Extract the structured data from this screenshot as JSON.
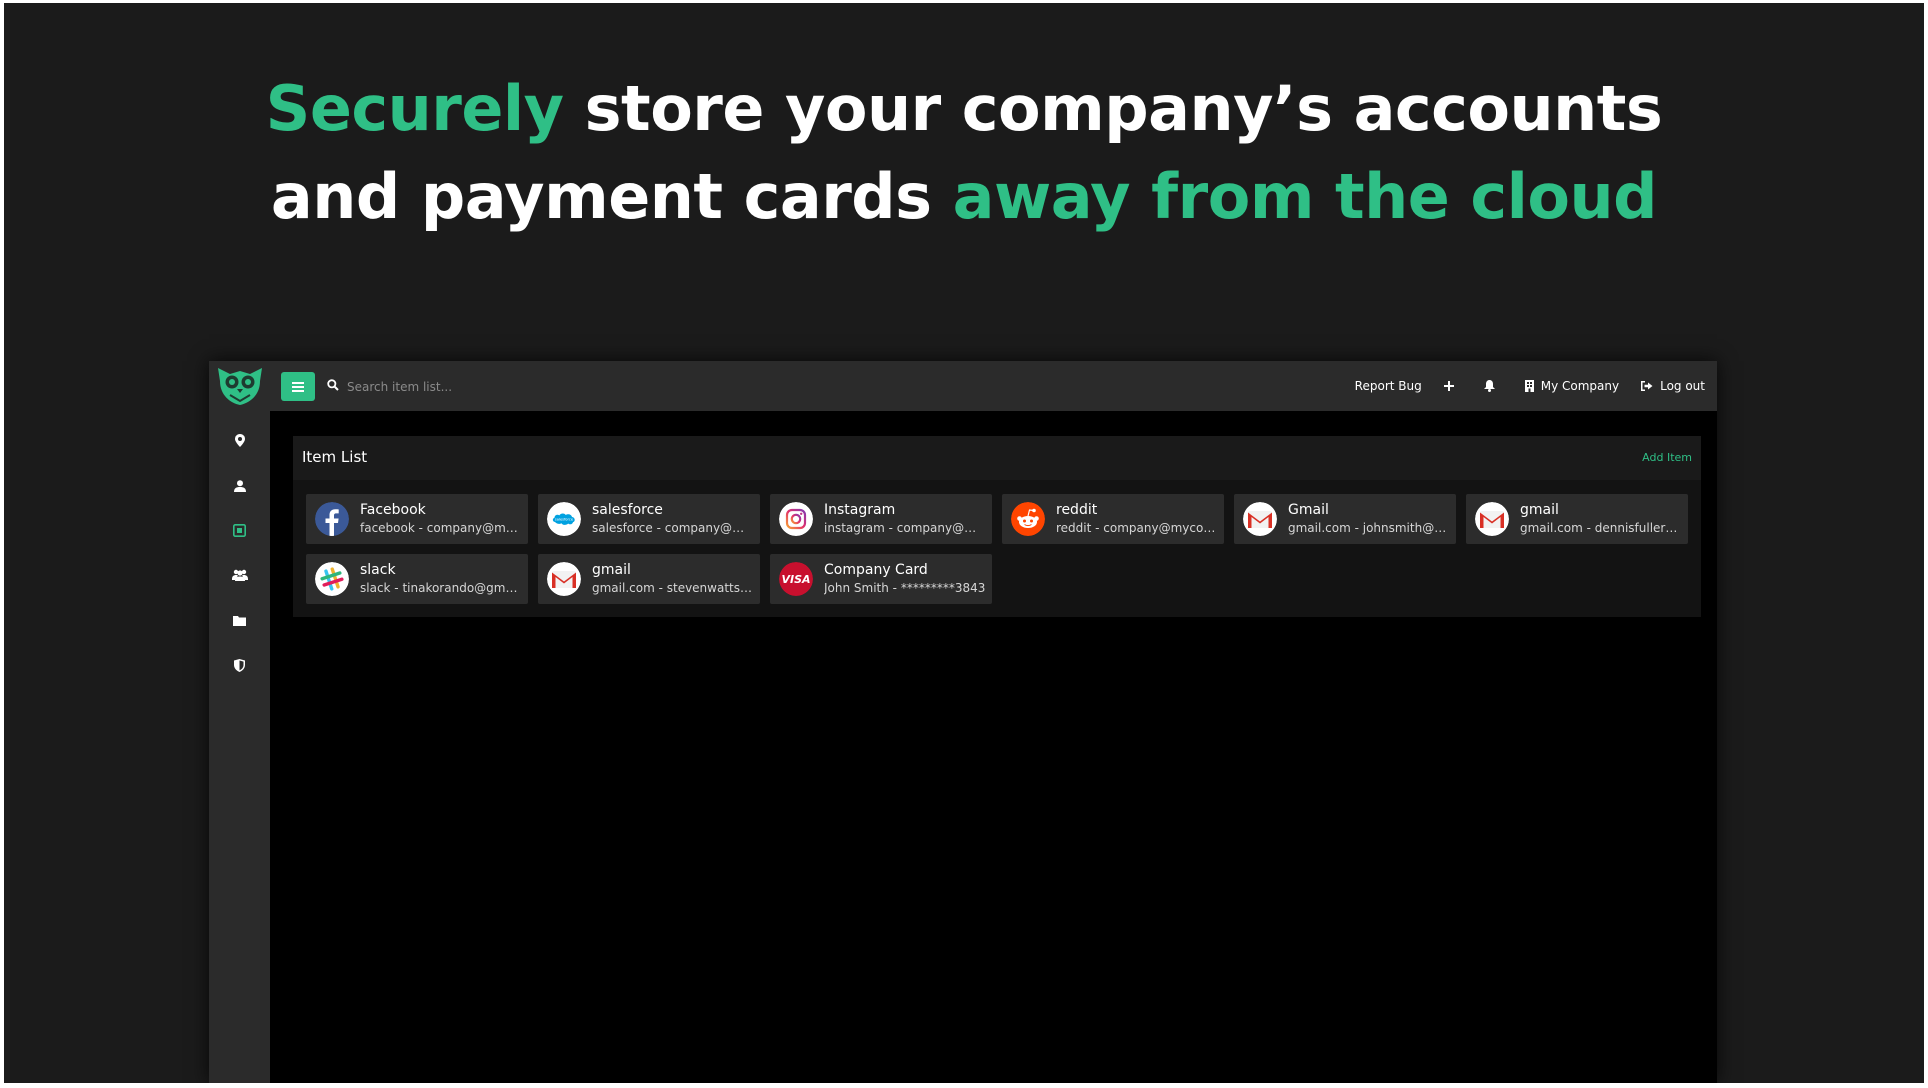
{
  "headline": {
    "line1_accent": "Securely",
    "line1_rest": " store your company’s accounts",
    "line2_start": "and payment cards ",
    "line2_accent": "away from the cloud"
  },
  "colors": {
    "accent": "#2fbf86",
    "sidebar": "#2b2b2b",
    "card": "#2c2c2c"
  },
  "sidebar": {
    "logo_icon": "owl-logo",
    "items": [
      {
        "icon": "map-pin-icon"
      },
      {
        "icon": "user-icon"
      },
      {
        "icon": "vault-icon",
        "active": true
      },
      {
        "icon": "users-icon"
      },
      {
        "icon": "folder-icon"
      },
      {
        "icon": "shield-icon"
      }
    ]
  },
  "topbar": {
    "search_placeholder": "Search item list...",
    "report_bug": "Report Bug",
    "company": "My Company",
    "logout": "Log out"
  },
  "panel": {
    "title": "Item List",
    "add_label": "Add Item"
  },
  "items": [
    {
      "name": "Facebook",
      "sub": "facebook - company@mycompany.com",
      "icon": "facebook-icon"
    },
    {
      "name": "salesforce",
      "sub": "salesforce - company@mycompany.com",
      "icon": "salesforce-icon"
    },
    {
      "name": "Instagram",
      "sub": "instagram - company@mycompany.com",
      "icon": "instagram-icon"
    },
    {
      "name": "reddit",
      "sub": "reddit - company@mycompany.com",
      "icon": "reddit-icon"
    },
    {
      "name": "Gmail",
      "sub": "gmail.com - johnsmith@gmail.com",
      "icon": "gmail-icon"
    },
    {
      "name": "gmail",
      "sub": "gmail.com - dennisfuller@gmail.com",
      "icon": "gmail-icon"
    },
    {
      "name": "slack",
      "sub": "slack - tinakorando@gmail.com",
      "icon": "slack-icon"
    },
    {
      "name": "gmail",
      "sub": "gmail.com - stevenwatts@gmail.com",
      "icon": "gmail-icon"
    },
    {
      "name": "Company Card",
      "sub": "John Smith - *********3843",
      "icon": "visa-icon"
    }
  ]
}
